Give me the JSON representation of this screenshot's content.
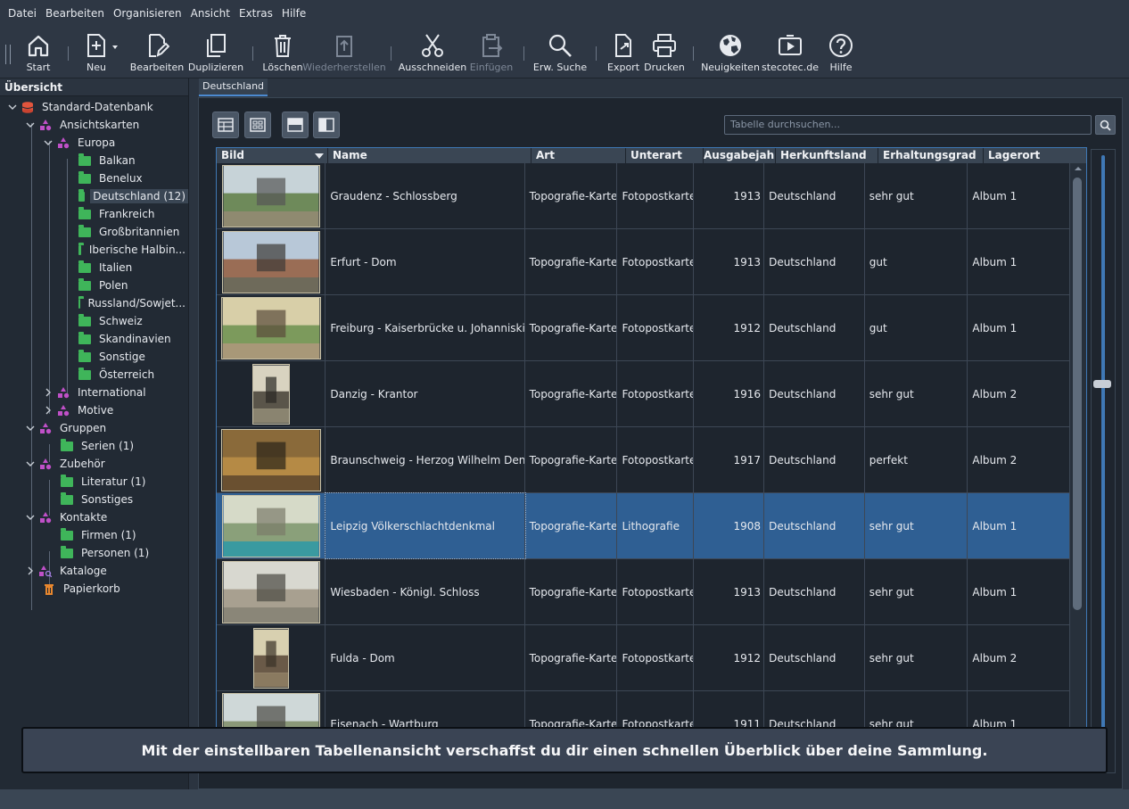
{
  "menu": [
    "Datei",
    "Bearbeiten",
    "Organisieren",
    "Ansicht",
    "Extras",
    "Hilfe"
  ],
  "toolbar": {
    "start": "Start",
    "neu": "Neu",
    "bearbeiten": "Bearbeiten",
    "duplizieren": "Duplizieren",
    "loeschen": "Löschen",
    "wiederherstellen": "Wiederherstellen",
    "ausschneiden": "Ausschneiden",
    "einfuegen": "Einfügen",
    "erw_suche": "Erw. Suche",
    "export": "Export",
    "drucken": "Drucken",
    "neuigkeiten": "Neuigkeiten",
    "stecotec": "stecotec.de",
    "hilfe": "Hilfe"
  },
  "sidebar": {
    "title": "Übersicht",
    "tree": [
      {
        "label": "Standard-Datenbank"
      },
      {
        "label": "Ansichtskarten"
      },
      {
        "label": "Europa"
      },
      {
        "label": "Balkan"
      },
      {
        "label": "Benelux"
      },
      {
        "label": "Deutschland (12)"
      },
      {
        "label": "Frankreich"
      },
      {
        "label": "Großbritannien"
      },
      {
        "label": "Iberische Halbin..."
      },
      {
        "label": "Italien"
      },
      {
        "label": "Polen"
      },
      {
        "label": "Russland/Sowjet..."
      },
      {
        "label": "Schweiz"
      },
      {
        "label": "Skandinavien"
      },
      {
        "label": "Sonstige"
      },
      {
        "label": "Österreich"
      },
      {
        "label": "International"
      },
      {
        "label": "Motive"
      },
      {
        "label": "Gruppen"
      },
      {
        "label": "Serien (1)"
      },
      {
        "label": "Zubehör"
      },
      {
        "label": "Literatur (1)"
      },
      {
        "label": "Sonstiges"
      },
      {
        "label": "Kontakte"
      },
      {
        "label": "Firmen (1)"
      },
      {
        "label": "Personen (1)"
      },
      {
        "label": "Kataloge"
      },
      {
        "label": "Papierkorb"
      }
    ]
  },
  "tab": {
    "label": "Deutschland"
  },
  "search": {
    "placeholder": "Tabelle durchsuchen..."
  },
  "table": {
    "columns": [
      "Bild",
      "Name",
      "Art",
      "Unterart",
      "Ausgabejahr",
      "Herkunftsland",
      "Erhaltungsgrad",
      "Lagerort"
    ],
    "rows": [
      {
        "name": "Graudenz - Schlossberg",
        "art": "Topografie-Karte",
        "unterart": "Fotopostkarten",
        "jahr": "1913",
        "land": "Deutschland",
        "zustand": "sehr gut",
        "lager": "Album 1"
      },
      {
        "name": "Erfurt - Dom",
        "art": "Topografie-Karte",
        "unterart": "Fotopostkarten",
        "jahr": "1913",
        "land": "Deutschland",
        "zustand": "gut",
        "lager": "Album 1"
      },
      {
        "name": "Freiburg - Kaiserbrücke u. Johanniskirche",
        "art": "Topografie-Karte",
        "unterart": "Fotopostkarten",
        "jahr": "1912",
        "land": "Deutschland",
        "zustand": "gut",
        "lager": "Album 1"
      },
      {
        "name": "Danzig - Krantor",
        "art": "Topografie-Karte",
        "unterart": "Fotopostkarten",
        "jahr": "1916",
        "land": "Deutschland",
        "zustand": "sehr gut",
        "lager": "Album 2"
      },
      {
        "name": "Braunschweig - Herzog Wilhelm Denkmal",
        "art": "Topografie-Karte",
        "unterart": "Fotopostkarten",
        "jahr": "1917",
        "land": "Deutschland",
        "zustand": "perfekt",
        "lager": "Album 2"
      },
      {
        "name": "Leipzig Völkerschlachtdenkmal",
        "art": "Topografie-Karte",
        "unterart": "Lithografie",
        "jahr": "1908",
        "land": "Deutschland",
        "zustand": "sehr gut",
        "lager": "Album 1"
      },
      {
        "name": "Wiesbaden - Königl. Schloss",
        "art": "Topografie-Karte",
        "unterart": "Fotopostkarten",
        "jahr": "1913",
        "land": "Deutschland",
        "zustand": "sehr gut",
        "lager": "Album 1"
      },
      {
        "name": "Fulda - Dom",
        "art": "Topografie-Karte",
        "unterart": "Fotopostkarten",
        "jahr": "1912",
        "land": "Deutschland",
        "zustand": "sehr gut",
        "lager": "Album 2"
      },
      {
        "name": "Eisenach - Wartburg",
        "art": "Topografie-Karte",
        "unterart": "Fotopostkarten",
        "jahr": "1911",
        "land": "Deutschland",
        "zustand": "sehr gut",
        "lager": "Album 1"
      }
    ]
  },
  "banner": {
    "text": "Mit der einstellbaren Tabellenansicht verschaffst du dir einen schnellen Überblick über deine Sammlung."
  },
  "colors": {
    "accent": "#3f78b5",
    "selection": "#2f5f93",
    "folder": "#3fb55a",
    "category": "#c050c8",
    "database": "#e2553d",
    "trash": "#e8872e"
  }
}
